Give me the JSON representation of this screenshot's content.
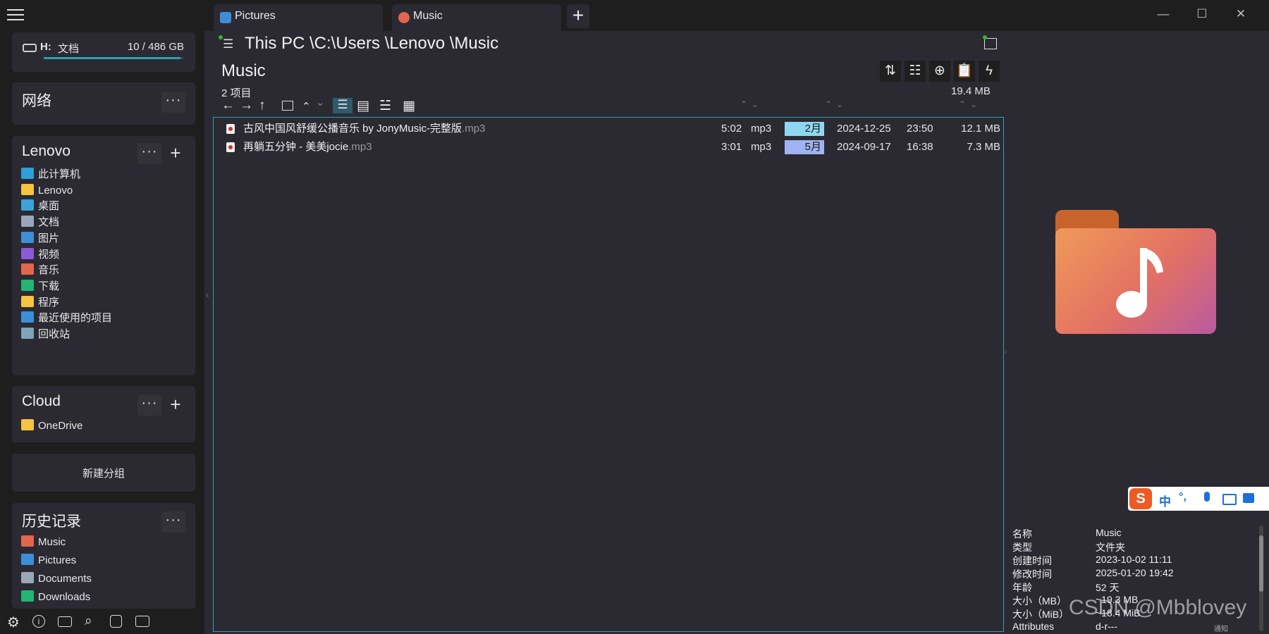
{
  "tabs": [
    {
      "label": "Pictures",
      "icon": "pictures-icon"
    },
    {
      "label": "Music",
      "icon": "music-icon"
    }
  ],
  "sidebar": {
    "drive": {
      "letter": "H:",
      "name": "文档",
      "usage": "10 / 486 GB",
      "fill": 0.98
    },
    "network": {
      "title": "网络"
    },
    "lenovo": {
      "title": "Lenovo",
      "items": [
        {
          "label": "此计算机",
          "color": "#2d9fd9"
        },
        {
          "label": "Lenovo",
          "color": "#f5c542"
        },
        {
          "label": "桌面",
          "color": "#3ba3d8"
        },
        {
          "label": "文档",
          "color": "#9aa7b8"
        },
        {
          "label": "图片",
          "color": "#3b8fd6"
        },
        {
          "label": "视频",
          "color": "#8d5ad8"
        },
        {
          "label": "音乐",
          "color": "#e0664e"
        },
        {
          "label": "下载",
          "color": "#22b573"
        },
        {
          "label": "程序",
          "color": "#f5c542"
        },
        {
          "label": "最近使用的项目",
          "color": "#3b8fd6"
        },
        {
          "label": "回收站",
          "color": "#7fa3b8"
        }
      ]
    },
    "cloud": {
      "title": "Cloud",
      "items": [
        {
          "label": "OneDrive",
          "color": "#f5c542"
        }
      ]
    },
    "new_group": "新建分组",
    "history": {
      "title": "历史记录",
      "items": [
        {
          "label": "Music",
          "color": "#e0664e"
        },
        {
          "label": "Pictures",
          "color": "#3b8fd6"
        },
        {
          "label": "Documents",
          "color": "#9aa7b8"
        },
        {
          "label": "Downloads",
          "color": "#22b573"
        }
      ]
    }
  },
  "path": "This PC \\C:\\Users \\Lenovo \\Music",
  "folder": {
    "title": "Music",
    "count": "2 项目",
    "total_size": "19.4 MB"
  },
  "files": [
    {
      "name": "古风中国风舒缓公播音乐 by JonyMusic-完整版",
      "ext": ".mp3",
      "duration": "5:02",
      "type": "mp3",
      "month": "2月",
      "month_color": "#8fd7f0",
      "date": "2024-12-25",
      "time": "23:50",
      "size": "12.1 MB"
    },
    {
      "name": "再躺五分钟 - 美美jocie",
      "ext": ".mp3",
      "duration": "3:01",
      "type": "mp3",
      "month": "5月",
      "month_color": "#9fb3f2",
      "date": "2024-09-17",
      "time": "16:38",
      "size": "7.3 MB"
    }
  ],
  "info": [
    {
      "key": "名称",
      "value": "Music"
    },
    {
      "key": "类型",
      "value": "文件夹"
    },
    {
      "key": "创建时间",
      "value": "2023-10-02  11:11"
    },
    {
      "key": "修改时间",
      "value": "2025-01-20  19:42"
    },
    {
      "key": "年龄",
      "value": "52 天"
    },
    {
      "key": "大小（MB）",
      "value": "~19.3 MB"
    },
    {
      "key": "大小（MiB）",
      "value": "~18.4 MiB"
    },
    {
      "key": "Attributes",
      "value": "d-r---"
    }
  ],
  "ime": {
    "lang": "中",
    "punct": "°,"
  },
  "watermark": "CSDN @Mbblovey",
  "taskbar_hint": "通知",
  "colors": {
    "accent": "#2ea1ad",
    "sidebar_bg": "#1e1e1e",
    "panel_bg": "#2b2a33"
  }
}
